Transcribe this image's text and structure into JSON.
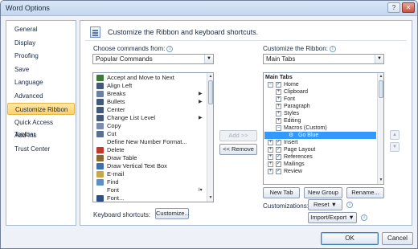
{
  "window": {
    "title": "Word Options",
    "help_glyph": "?",
    "close_glyph": "✕"
  },
  "sidebar": {
    "items": [
      {
        "label": "General"
      },
      {
        "label": "Display"
      },
      {
        "label": "Proofing"
      },
      {
        "label": "Save"
      },
      {
        "label": "Language"
      },
      {
        "label": "Advanced"
      },
      {
        "label": "Customize Ribbon",
        "selected": true
      },
      {
        "label": "Quick Access Toolbar"
      },
      {
        "label": "Add-Ins"
      },
      {
        "label": "Trust Center"
      }
    ]
  },
  "header": {
    "text": "Customize the Ribbon and keyboard shortcuts."
  },
  "left": {
    "choose_label": "Choose commands from:",
    "choose_value": "Popular Commands",
    "commands": [
      {
        "label": "Accept and Move to Next",
        "icon_color": "#3b7a3b"
      },
      {
        "label": "Align Left",
        "icon_color": "#44597a"
      },
      {
        "label": "Breaks",
        "icon_color": "#6a7fa3",
        "sub": "▶"
      },
      {
        "label": "Bullets",
        "icon_color": "#44597a",
        "sub": "▶"
      },
      {
        "label": "Center",
        "icon_color": "#44597a"
      },
      {
        "label": "Change List Level",
        "icon_color": "#44597a",
        "sub": "▶"
      },
      {
        "label": "Copy",
        "icon_color": "#7a8db0"
      },
      {
        "label": "Cut",
        "icon_color": "#5a6f92"
      },
      {
        "label": "Define New Number Format...",
        "icon_color": ""
      },
      {
        "label": "Delete",
        "icon_color": "#c0392b"
      },
      {
        "label": "Draw Table",
        "icon_color": "#8a6a2f"
      },
      {
        "label": "Draw Vertical Text Box",
        "icon_color": "#3f6fae"
      },
      {
        "label": "E-mail",
        "icon_color": "#c9a64a"
      },
      {
        "label": "Find",
        "icon_color": "#5b8fc7"
      },
      {
        "label": "Font",
        "icon_color": "",
        "sub": "I▾"
      },
      {
        "label": "Font...",
        "icon_color": "#2e4f86"
      }
    ],
    "keyboard_label": "Keyboard shortcuts:",
    "customize_button": "Customize..."
  },
  "middle": {
    "add_button": "Add >>",
    "remove_button": "<< Remove"
  },
  "right": {
    "customize_label": "Customize the Ribbon:",
    "customize_value": "Main Tabs",
    "tree_header": "Main Tabs",
    "tree": [
      {
        "label": "Home",
        "level": 0,
        "exp": "−",
        "check": true
      },
      {
        "label": "Clipboard",
        "level": 1,
        "exp": "+"
      },
      {
        "label": "Font",
        "level": 1,
        "exp": "+"
      },
      {
        "label": "Paragraph",
        "level": 1,
        "exp": "+"
      },
      {
        "label": "Styles",
        "level": 1,
        "exp": "+"
      },
      {
        "label": "Editing",
        "level": 1,
        "exp": "+"
      },
      {
        "label": "Macros (Custom)",
        "level": 1,
        "exp": "−"
      },
      {
        "label": "Go Blue",
        "level": 2,
        "selected": true
      },
      {
        "label": "Insert",
        "level": 0,
        "exp": "+",
        "check": true
      },
      {
        "label": "Page Layout",
        "level": 0,
        "exp": "+",
        "check": true
      },
      {
        "label": "References",
        "level": 0,
        "exp": "+",
        "check": true
      },
      {
        "label": "Mailings",
        "level": 0,
        "exp": "+",
        "check": true
      },
      {
        "label": "Review",
        "level": 0,
        "exp": "+",
        "check": true
      }
    ],
    "new_tab": "New Tab",
    "new_group": "New Group",
    "rename": "Rename...",
    "customizations_label": "Customizations:",
    "reset": "Reset ▼",
    "import_export": "Import/Export ▼",
    "move_up": "▲",
    "move_down": "▼"
  },
  "footer": {
    "ok": "OK",
    "cancel": "Cancel"
  }
}
